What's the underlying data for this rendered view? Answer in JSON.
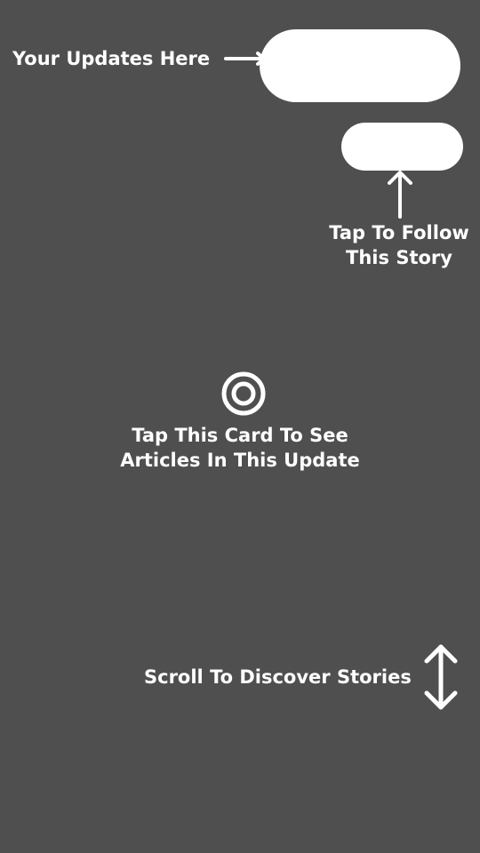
{
  "coachmarks": {
    "updates": {
      "label": "Your Updates Here",
      "arrow_icon": "arrow-right-icon"
    },
    "follow": {
      "line1": "Tap To Follow",
      "line2": "This Story",
      "arrow_icon": "arrow-up-icon"
    },
    "card": {
      "line1": "Tap This Card To See",
      "line2": "Articles In This Update",
      "icon": "target-icon"
    },
    "scroll": {
      "label": "Scroll To Discover Stories",
      "icon": "arrow-up-down-icon"
    }
  },
  "colors": {
    "background": "#4f4f4f",
    "foreground": "#ffffff"
  }
}
